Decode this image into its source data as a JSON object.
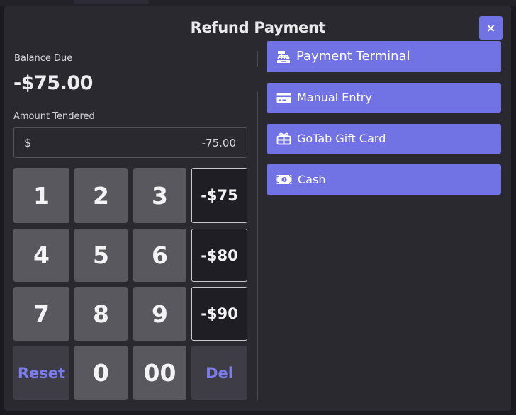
{
  "modal": {
    "title": "Refund Payment",
    "close_label": "×"
  },
  "balance": {
    "label": "Balance Due",
    "value": "-$75.00"
  },
  "tender": {
    "label": "Amount Tendered",
    "currency_symbol": "$",
    "value": "-75.00"
  },
  "keypad": {
    "digits": [
      "1",
      "2",
      "3",
      "4",
      "5",
      "6",
      "7",
      "8",
      "9",
      "0",
      "00"
    ],
    "quick_amounts": [
      "-$75",
      "-$80",
      "-$90"
    ],
    "reset_label": "Reset",
    "delete_label": "Del"
  },
  "payment_methods": [
    {
      "label": "Payment Terminal",
      "icon": "cash-register-icon"
    },
    {
      "label": "Manual Entry",
      "icon": "credit-card-icon"
    },
    {
      "label": "GoTab Gift Card",
      "icon": "gift-icon"
    },
    {
      "label": "Cash",
      "icon": "money-bill-icon"
    }
  ],
  "colors": {
    "accent": "#7173e4",
    "modal_background": "#2a2930",
    "key_background": "#59585f"
  }
}
